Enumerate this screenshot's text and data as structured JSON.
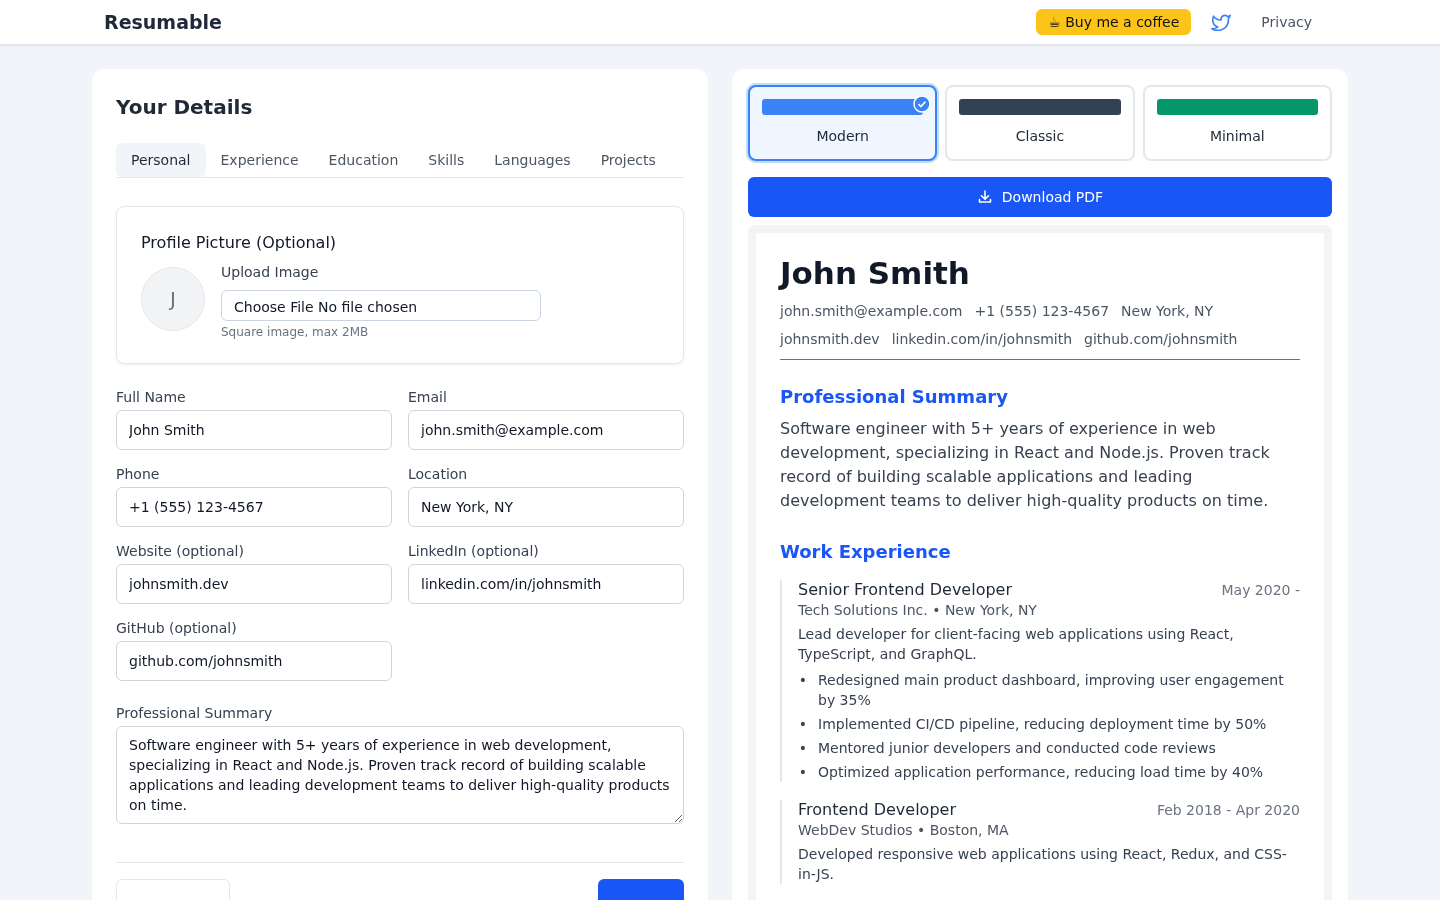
{
  "header": {
    "logo": "Resumable",
    "coffee_button": "☕ Buy me a coffee",
    "privacy_link": "Privacy"
  },
  "editor": {
    "title": "Your Details",
    "tabs": [
      {
        "label": "Personal",
        "selected": true
      },
      {
        "label": "Experience",
        "selected": false
      },
      {
        "label": "Education",
        "selected": false
      },
      {
        "label": "Skills",
        "selected": false
      },
      {
        "label": "Languages",
        "selected": false
      },
      {
        "label": "Projects",
        "selected": false
      }
    ],
    "profile_picture": {
      "title": "Profile Picture (Optional)",
      "avatar_initial": "J",
      "upload_label": "Upload Image",
      "file_button": "Choose File",
      "file_status": "No file chosen",
      "hint": "Square image, max 2MB"
    },
    "fields": [
      {
        "label": "Full Name",
        "value": "John Smith"
      },
      {
        "label": "Email",
        "value": "john.smith@example.com"
      },
      {
        "label": "Phone",
        "value": "+1 (555) 123-4567"
      },
      {
        "label": "Location",
        "value": "New York, NY"
      },
      {
        "label": "Website (optional)",
        "value": "johnsmith.dev"
      },
      {
        "label": "LinkedIn (optional)",
        "value": "linkedin.com/in/johnsmith"
      },
      {
        "label": "GitHub (optional)",
        "value": "github.com/johnsmith"
      }
    ],
    "summary": {
      "label": "Professional Summary",
      "value": "Software engineer with 5+ years of experience in web development, specializing in React and Node.js. Proven track record of building scalable applications and leading development teams to deliver high-quality products on time."
    }
  },
  "templates": [
    {
      "label": "Modern",
      "color": "#3b82f6",
      "selected": true
    },
    {
      "label": "Classic",
      "color": "#334155",
      "selected": false
    },
    {
      "label": "Minimal",
      "color": "#059669",
      "selected": false
    }
  ],
  "download_button": "Download PDF",
  "preview": {
    "name": "John Smith",
    "contact_line_1": [
      "john.smith@example.com",
      "+1 (555) 123-4567",
      "New York, NY"
    ],
    "contact_line_2": [
      "johnsmith.dev",
      "linkedin.com/in/johnsmith",
      "github.com/johnsmith"
    ],
    "summary_heading": "Professional Summary",
    "summary": "Software engineer with 5+ years of experience in web development, specializing in React and Node.js. Proven track record of building scalable applications and leading development teams to deliver high-quality products on time.",
    "experience_heading": "Work Experience",
    "jobs": [
      {
        "title": "Senior Frontend Developer",
        "dates": "May 2020 -",
        "company": "Tech Solutions Inc. • New York, NY",
        "description": "Lead developer for client-facing web applications using React, TypeScript, and GraphQL.",
        "bullets": [
          "Redesigned main product dashboard, improving user engagement by 35%",
          "Implemented CI/CD pipeline, reducing deployment time by 50%",
          "Mentored junior developers and conducted code reviews",
          "Optimized application performance, reducing load time by 40%"
        ]
      },
      {
        "title": "Frontend Developer",
        "dates": "Feb 2018 - Apr 2020",
        "company": "WebDev Studios • Boston, MA",
        "description": "Developed responsive web applications using React, Redux, and CSS-in-JS."
      }
    ],
    "bullet_marker": "•"
  }
}
